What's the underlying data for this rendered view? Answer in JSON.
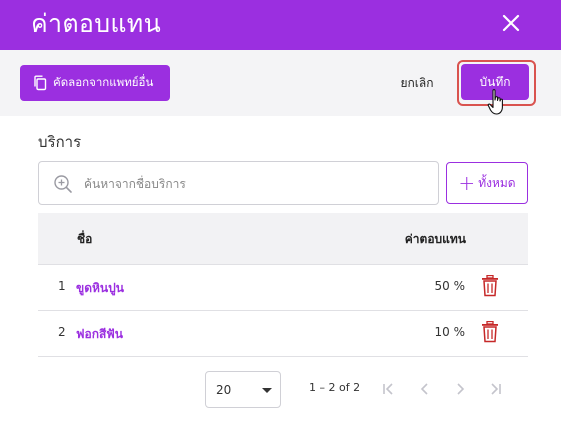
{
  "header": {
    "title": "ค่าตอบแทน"
  },
  "toolbar": {
    "copy_label": "คัดลอกจากแพทย์อื่น",
    "cancel_label": "ยกเลิก",
    "save_label": "บันทึก"
  },
  "services": {
    "title": "บริการ",
    "search_placeholder": "ค้นหาจากชื่อบริการ",
    "add_all_label": "ทั้งหมด"
  },
  "table": {
    "columns": [
      "ชื่อ",
      "ค่าตอบแทน"
    ],
    "rows": [
      {
        "index": "1",
        "name": "ขูดหินปูน",
        "fee": "50 %"
      },
      {
        "index": "2",
        "name": "ฟอกสีฟัน",
        "fee": "10 %"
      }
    ]
  },
  "pagination": {
    "page_size": "20",
    "range": "1 – 2 of 2"
  },
  "colors": {
    "accent": "#9b2fe0",
    "danger": "#c62828",
    "highlight": "#d9534f"
  }
}
